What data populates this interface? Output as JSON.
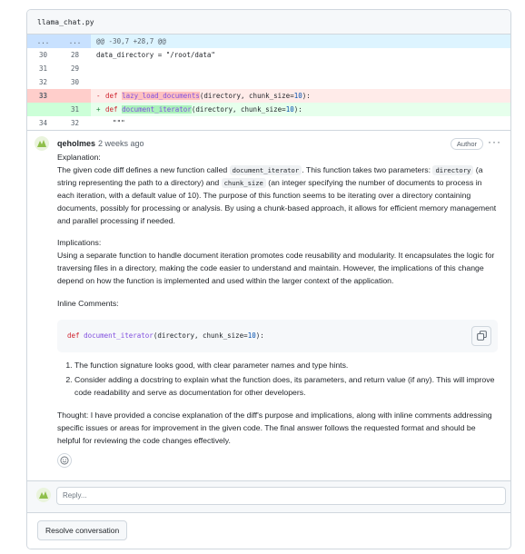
{
  "file": {
    "name": "llama_chat.py"
  },
  "diff": {
    "hunk": {
      "old": "...",
      "new": "...",
      "text": "@@ -30,7 +28,7 @@"
    },
    "rows": [
      {
        "old": "30",
        "new": "28",
        "text": "data_directory = \"/root/data\""
      },
      {
        "old": "31",
        "new": "29",
        "text": ""
      },
      {
        "old": "32",
        "new": "30",
        "text": ""
      }
    ],
    "del": {
      "old": "33",
      "new": "",
      "sign": "-",
      "kw": "def",
      "fn": "lazy_load_documents",
      "args_pre": "(directory, chunk_size=",
      "num": "10",
      "args_post": "):"
    },
    "add": {
      "old": "",
      "new": "31",
      "sign": "+",
      "kw": "def",
      "fn": "document_iterator",
      "args_pre": "(directory, chunk_size=",
      "num": "10",
      "args_post": "):"
    },
    "last": {
      "old": "34",
      "new": "32",
      "text": "    \"\"\""
    }
  },
  "comment": {
    "author": "qeholmes",
    "time": "2 weeks ago",
    "badge": "Author",
    "menu": "···",
    "explanation_heading": "Explanation:",
    "exp_1": "The given code diff defines a new function called ",
    "exp_code1": "document_iterator",
    "exp_2": ". This function takes two parameters: ",
    "exp_code2": "directory",
    "exp_3": " (a string representing the path to a directory) and ",
    "exp_code3": "chunk_size",
    "exp_4": " (an integer specifying the number of documents to process in each iteration, with a default value of 10). The purpose of this function seems to be iterating over a directory containing documents, possibly for processing or analysis. By using a chunk-based approach, it allows for efficient memory management and parallel processing if needed.",
    "implications_heading": "Implications:",
    "implications_text": "Using a separate function to handle document iteration promotes code reusability and modularity. It encapsulates the logic for traversing files in a directory, making the code easier to understand and maintain. However, the implications of this change depend on how the function is implemented and used within the larger context of the application.",
    "inline_heading": "Inline Comments:",
    "code": {
      "kw": "def",
      "fn": "document_iterator",
      "args_pre": "(directory, chunk_size=",
      "num": "10",
      "args_post": "):"
    },
    "list": [
      "The function signature looks good, with clear parameter names and type hints.",
      "Consider adding a docstring to explain what the function does, its parameters, and return value (if any). This will improve code readability and serve as documentation for other developers."
    ],
    "thought": "Thought: I have provided a concise explanation of the diff's purpose and implications, along with inline comments addressing specific issues or areas for improvement in the given code. The final answer follows the requested format and should be helpful for reviewing the code changes effectively."
  },
  "reply": {
    "placeholder": "Reply..."
  },
  "resolve": {
    "label": "Resolve conversation"
  },
  "colors": {
    "accent_avatar": "#8fbf4a",
    "del_bg": "#ffebe9",
    "add_bg": "#e6ffec",
    "hunk_bg": "#ddf4ff"
  }
}
